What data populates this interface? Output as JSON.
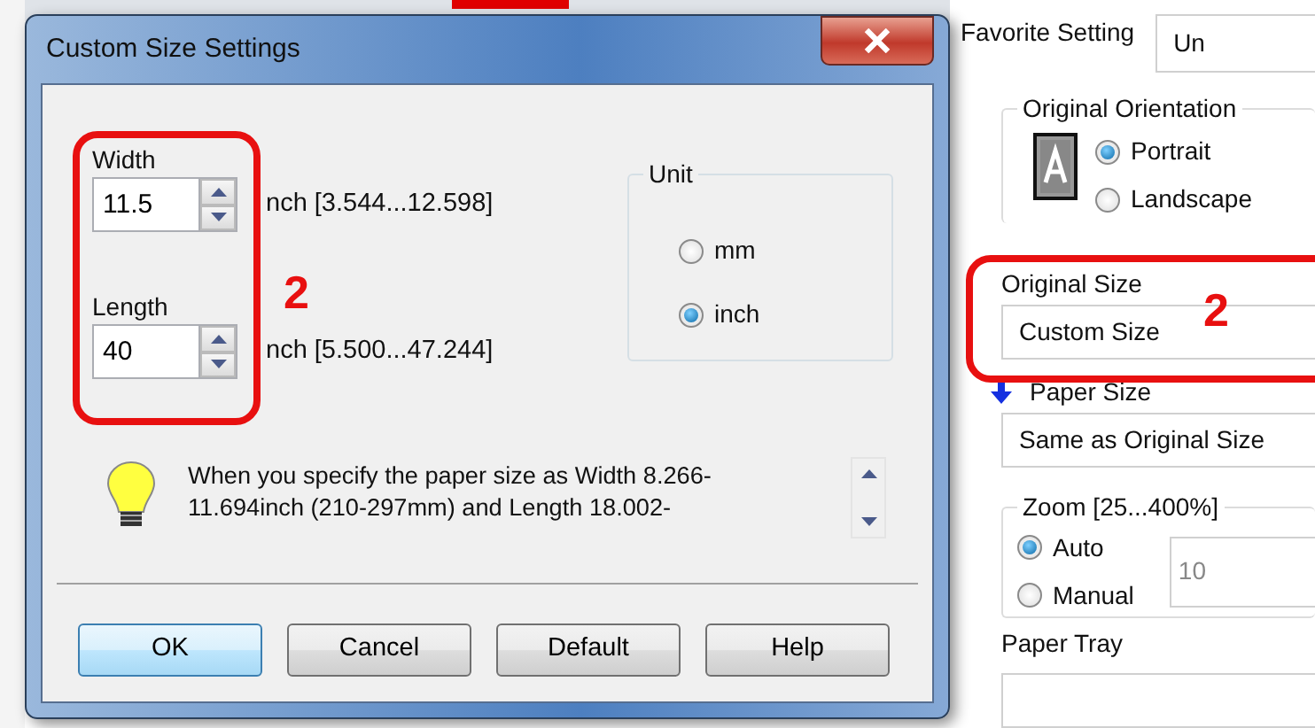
{
  "dialog": {
    "title": "Custom Size Settings",
    "fields": [
      {
        "label": "Width",
        "value": "11.5",
        "range": "nch [3.544...12.598]"
      },
      {
        "label": "Length",
        "value": "40",
        "range": "nch [5.500...47.244]"
      }
    ],
    "unit": {
      "title": "Unit",
      "options": [
        {
          "label": "mm",
          "selected": false
        },
        {
          "label": "inch",
          "selected": true
        }
      ]
    },
    "tip_lines": [
      "When you specify the paper size as Width 8.266-",
      "11.694inch (210-297mm) and Length 18.002-"
    ],
    "buttons": [
      {
        "label": "OK",
        "default": true
      },
      {
        "label": "Cancel",
        "default": false
      },
      {
        "label": "Default",
        "default": false
      },
      {
        "label": "Help",
        "default": false
      }
    ],
    "annotation": "2"
  },
  "settings_panel": {
    "favorite_setting": {
      "label": "Favorite Setting",
      "value": "Un"
    },
    "orientation": {
      "title": "Original Orientation",
      "options": [
        {
          "label": "Portrait",
          "selected": true
        },
        {
          "label": "Landscape",
          "selected": false
        }
      ]
    },
    "original_size": {
      "label": "Original Size",
      "value": "Custom Size",
      "annotation": "2"
    },
    "paper_size": {
      "label": "Paper Size",
      "value": "Same as Original Size"
    },
    "zoom": {
      "title": "Zoom [25...400%]",
      "options": [
        {
          "label": "Auto",
          "selected": true
        },
        {
          "label": "Manual",
          "selected": false
        }
      ],
      "value": "10",
      "disabled": true
    },
    "paper_tray": {
      "label": "Paper Tray"
    }
  }
}
